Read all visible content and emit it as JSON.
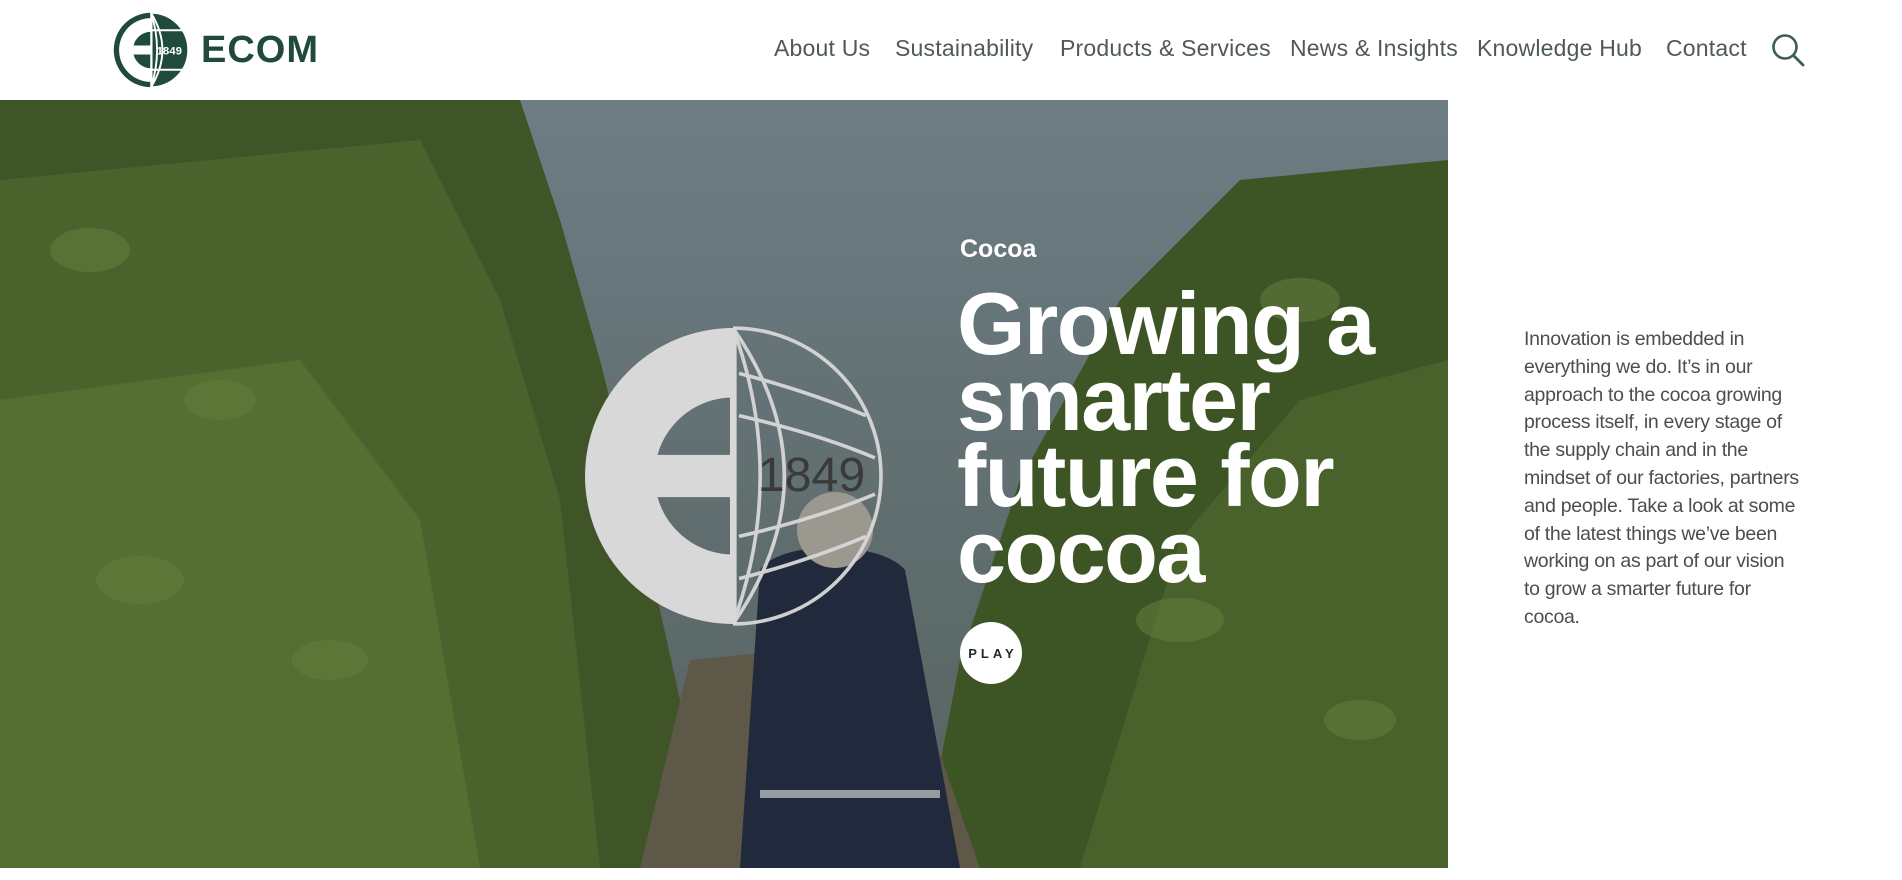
{
  "brand": {
    "name": "ECOM",
    "emblem_year": "1849",
    "color": "#1f4a3c"
  },
  "nav": {
    "items": [
      {
        "label": "About Us"
      },
      {
        "label": "Sustainability"
      },
      {
        "label": "Products & Services"
      },
      {
        "label": "News & Insights"
      },
      {
        "label": "Knowledge Hub"
      },
      {
        "label": "Contact"
      }
    ],
    "search_icon": "search-icon"
  },
  "hero": {
    "eyebrow": "Cocoa",
    "title_lines": [
      "Growing a",
      "smarter",
      "future for",
      "cocoa"
    ],
    "play_label": "PLAY",
    "emblem_year": "1849"
  },
  "intro": {
    "text": "Innovation is embedded in everything we do. It’s in our approach to the cocoa growing process itself, in every stage of the supply chain and in the mindset of our factories, partners and people. Take a look at some of the latest things we’ve been working on as part of our vision to grow a smarter future for cocoa."
  }
}
